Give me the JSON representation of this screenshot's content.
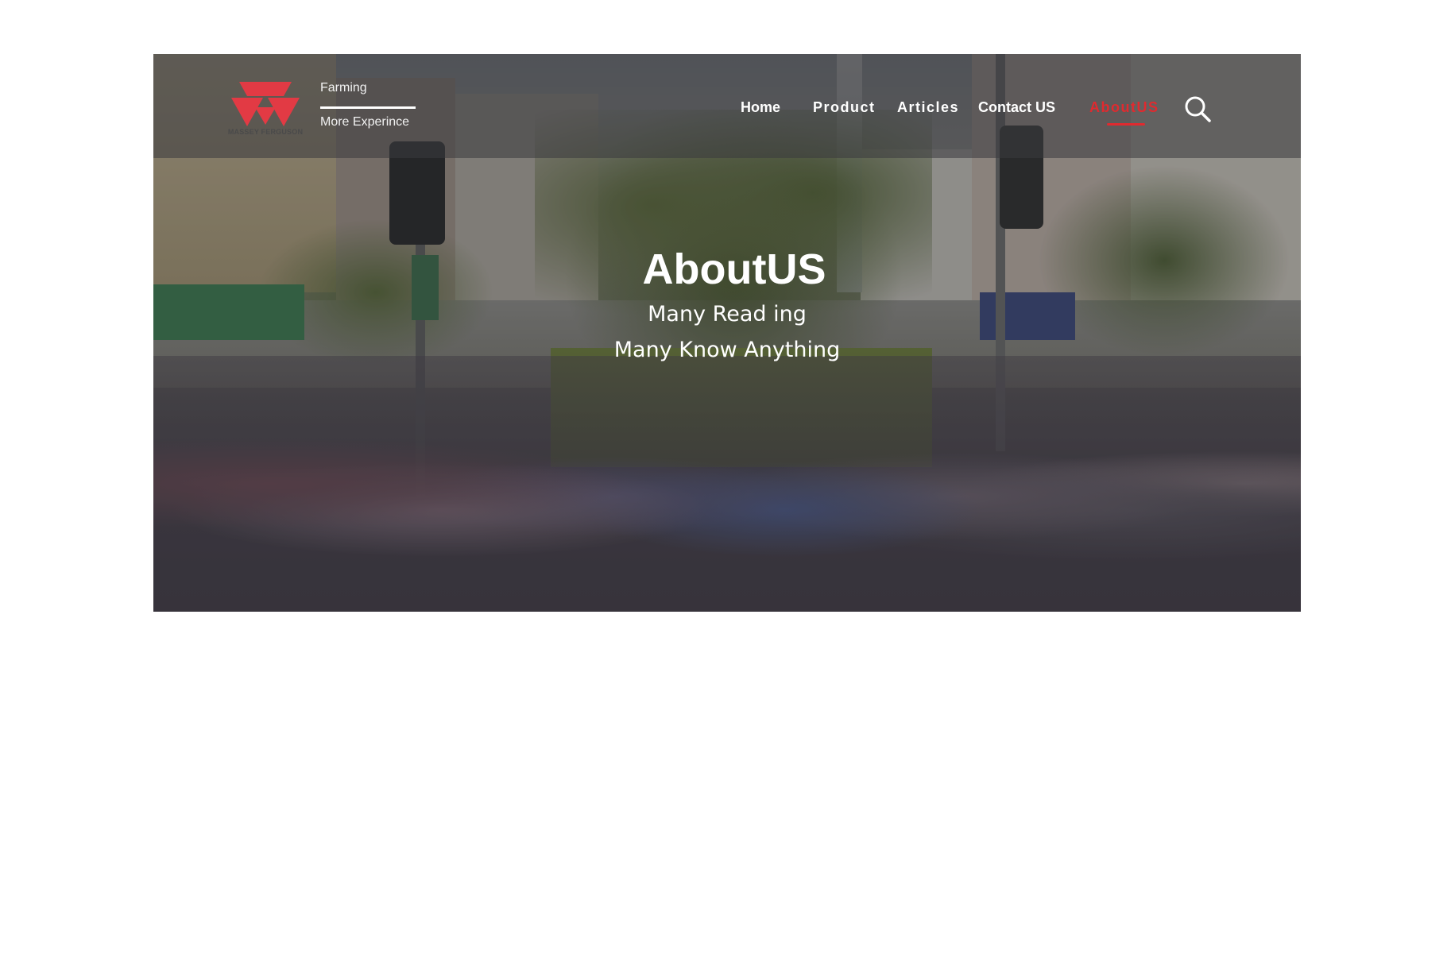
{
  "brand": {
    "logo_text": "MASSEY FERGUSON",
    "tagline_line1": "Farming",
    "tagline_line2": "More Experince",
    "accent_color": "#e02a2f"
  },
  "nav": {
    "items": [
      {
        "label": "Home"
      },
      {
        "label": "Product"
      },
      {
        "label": "Articles"
      },
      {
        "label": "Contact US"
      },
      {
        "label": "AboutUS",
        "active": true
      }
    ],
    "search_icon": "search-icon"
  },
  "hero": {
    "title": "AboutUS",
    "subtitle_line1": "Many Read ing",
    "subtitle_line2": "Many Know Anything"
  }
}
